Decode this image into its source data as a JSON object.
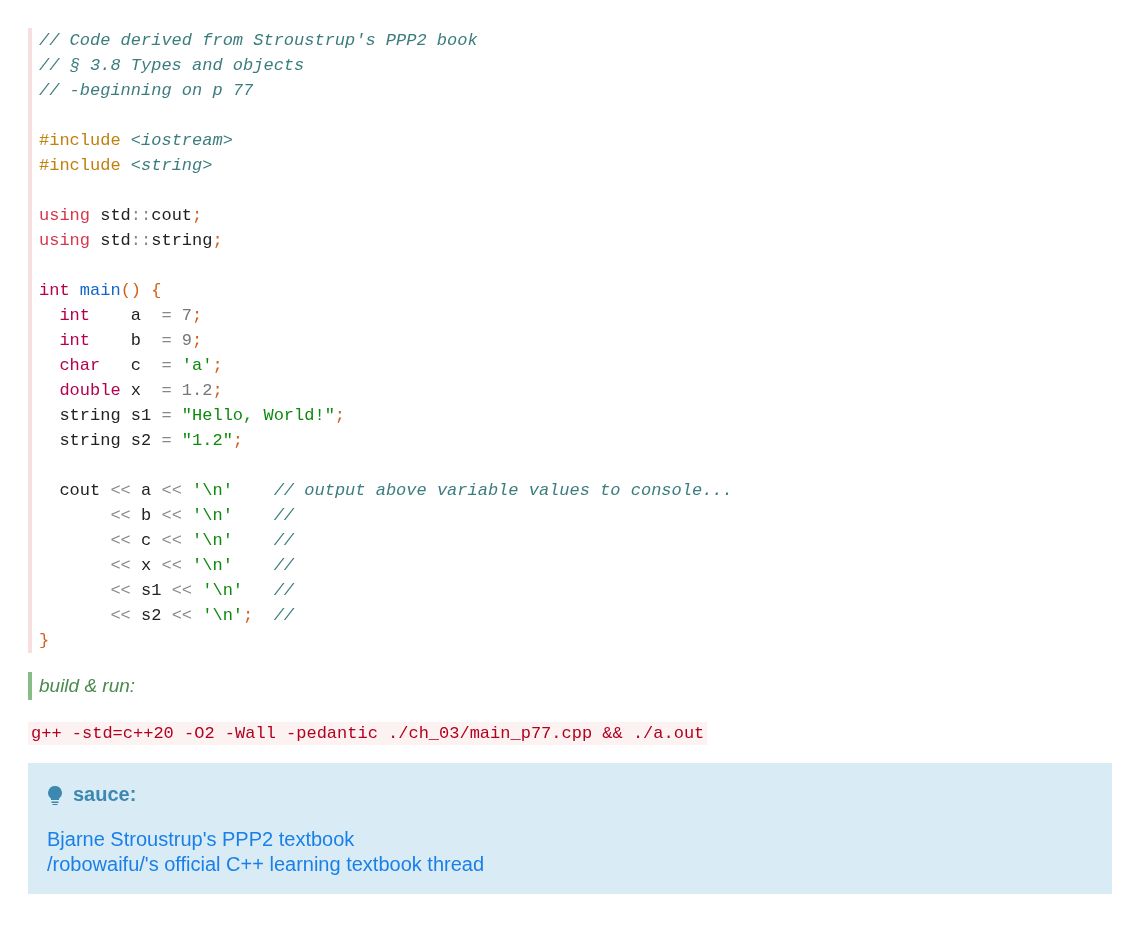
{
  "code": {
    "lines": [
      {
        "kind": "code",
        "tokens": [
          {
            "kind": "comment",
            "text": "// Code derived from Stroustrup's PPP2 book"
          }
        ]
      },
      {
        "kind": "code",
        "tokens": [
          {
            "kind": "comment",
            "text": "// § 3.8 Types and objects"
          }
        ]
      },
      {
        "kind": "code",
        "tokens": [
          {
            "kind": "comment",
            "text": "// -beginning on p 77"
          }
        ]
      },
      {
        "kind": "blank"
      },
      {
        "kind": "code",
        "tokens": [
          {
            "kind": "preproc",
            "text": "#include"
          },
          {
            "kind": "include",
            "text": " <iostream>"
          }
        ]
      },
      {
        "kind": "code",
        "tokens": [
          {
            "kind": "preproc",
            "text": "#include"
          },
          {
            "kind": "include",
            "text": " <string>"
          }
        ]
      },
      {
        "kind": "blank"
      },
      {
        "kind": "code",
        "tokens": [
          {
            "kind": "keyword",
            "text": "using"
          },
          {
            "kind": "plain",
            "text": " std"
          },
          {
            "kind": "op",
            "text": "::"
          },
          {
            "kind": "plain",
            "text": "cout"
          },
          {
            "kind": "punct",
            "text": ";"
          }
        ]
      },
      {
        "kind": "code",
        "tokens": [
          {
            "kind": "keyword",
            "text": "using"
          },
          {
            "kind": "plain",
            "text": " std"
          },
          {
            "kind": "op",
            "text": "::"
          },
          {
            "kind": "plain",
            "text": "string"
          },
          {
            "kind": "punct",
            "text": ";"
          }
        ]
      },
      {
        "kind": "blank"
      },
      {
        "kind": "code",
        "tokens": [
          {
            "kind": "type",
            "text": "int"
          },
          {
            "kind": "func",
            "text": " main"
          },
          {
            "kind": "punct",
            "text": "() {"
          }
        ]
      },
      {
        "kind": "code",
        "tokens": [
          {
            "kind": "type",
            "text": "  int"
          },
          {
            "kind": "plain",
            "text": "    a  "
          },
          {
            "kind": "op",
            "text": "="
          },
          {
            "kind": "number",
            "text": " 7"
          },
          {
            "kind": "punct",
            "text": ";"
          }
        ]
      },
      {
        "kind": "code",
        "tokens": [
          {
            "kind": "type",
            "text": "  int"
          },
          {
            "kind": "plain",
            "text": "    b  "
          },
          {
            "kind": "op",
            "text": "="
          },
          {
            "kind": "number",
            "text": " 9"
          },
          {
            "kind": "punct",
            "text": ";"
          }
        ]
      },
      {
        "kind": "code",
        "tokens": [
          {
            "kind": "type",
            "text": "  char"
          },
          {
            "kind": "plain",
            "text": "   c  "
          },
          {
            "kind": "op",
            "text": "="
          },
          {
            "kind": "string",
            "text": " 'a'"
          },
          {
            "kind": "punct",
            "text": ";"
          }
        ]
      },
      {
        "kind": "code",
        "tokens": [
          {
            "kind": "type",
            "text": "  double"
          },
          {
            "kind": "plain",
            "text": " x  "
          },
          {
            "kind": "op",
            "text": "="
          },
          {
            "kind": "number",
            "text": " 1.2"
          },
          {
            "kind": "punct",
            "text": ";"
          }
        ]
      },
      {
        "kind": "code",
        "tokens": [
          {
            "kind": "plain",
            "text": "  string s1 "
          },
          {
            "kind": "op",
            "text": "="
          },
          {
            "kind": "string",
            "text": " \"Hello, World!\""
          },
          {
            "kind": "punct",
            "text": ";"
          }
        ]
      },
      {
        "kind": "code",
        "tokens": [
          {
            "kind": "plain",
            "text": "  string s2 "
          },
          {
            "kind": "op",
            "text": "="
          },
          {
            "kind": "string",
            "text": " \"1.2\""
          },
          {
            "kind": "punct",
            "text": ";"
          }
        ]
      },
      {
        "kind": "blank"
      },
      {
        "kind": "code",
        "tokens": [
          {
            "kind": "plain",
            "text": "  cout "
          },
          {
            "kind": "op",
            "text": "<<"
          },
          {
            "kind": "plain",
            "text": " a "
          },
          {
            "kind": "op",
            "text": "<<"
          },
          {
            "kind": "string",
            "text": " '\\n'"
          },
          {
            "kind": "comment",
            "text": "    // output above variable values to console..."
          }
        ]
      },
      {
        "kind": "code",
        "tokens": [
          {
            "kind": "op",
            "text": "       <<"
          },
          {
            "kind": "plain",
            "text": " b "
          },
          {
            "kind": "op",
            "text": "<<"
          },
          {
            "kind": "string",
            "text": " '\\n'"
          },
          {
            "kind": "comment",
            "text": "    //"
          }
        ]
      },
      {
        "kind": "code",
        "tokens": [
          {
            "kind": "op",
            "text": "       <<"
          },
          {
            "kind": "plain",
            "text": " c "
          },
          {
            "kind": "op",
            "text": "<<"
          },
          {
            "kind": "string",
            "text": " '\\n'"
          },
          {
            "kind": "comment",
            "text": "    //"
          }
        ]
      },
      {
        "kind": "code",
        "tokens": [
          {
            "kind": "op",
            "text": "       <<"
          },
          {
            "kind": "plain",
            "text": " x "
          },
          {
            "kind": "op",
            "text": "<<"
          },
          {
            "kind": "string",
            "text": " '\\n'"
          },
          {
            "kind": "comment",
            "text": "    //"
          }
        ]
      },
      {
        "kind": "code",
        "tokens": [
          {
            "kind": "op",
            "text": "       <<"
          },
          {
            "kind": "plain",
            "text": " s1 "
          },
          {
            "kind": "op",
            "text": "<<"
          },
          {
            "kind": "string",
            "text": " '\\n'"
          },
          {
            "kind": "comment",
            "text": "   //"
          }
        ]
      },
      {
        "kind": "code",
        "tokens": [
          {
            "kind": "op",
            "text": "       <<"
          },
          {
            "kind": "plain",
            "text": " s2 "
          },
          {
            "kind": "op",
            "text": "<<"
          },
          {
            "kind": "string",
            "text": " '\\n'"
          },
          {
            "kind": "punct",
            "text": ";"
          },
          {
            "kind": "comment",
            "text": "  //"
          }
        ]
      },
      {
        "kind": "code",
        "tokens": [
          {
            "kind": "punct",
            "text": "}"
          }
        ]
      }
    ]
  },
  "note": {
    "text": "build & run:"
  },
  "command": {
    "text": "g++ -std=c++20 -O2 -Wall -pedantic ./ch_03/main_p77.cpp && ./a.out"
  },
  "callout": {
    "title": "sauce:",
    "links": [
      "Bjarne Stroustrup's PPP2 textbook",
      "/robowaifu/'s official C++ learning textbook thread"
    ]
  }
}
